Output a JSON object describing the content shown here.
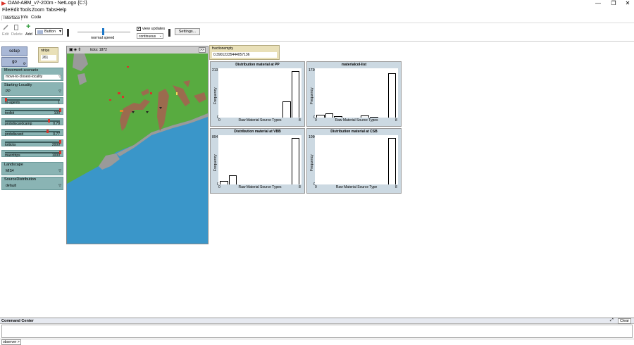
{
  "window": {
    "title": "OAM-ABM_v7-200m - NetLogo {C:\\}",
    "minimize": "—",
    "maximize": "❐",
    "close": "✕"
  },
  "menu": [
    "File",
    "Edit",
    "Tools",
    "Zoom",
    "Tabs",
    "Help"
  ],
  "tabs": [
    "Interface",
    "Info",
    "Code"
  ],
  "toolbar": {
    "edit": "Edit",
    "delete": "Delete",
    "add": "Add",
    "widget_type": "Button",
    "speed_label": "normal speed",
    "view_updates": "view updates",
    "update_mode": "continuous",
    "settings": "Settings..."
  },
  "buttons": {
    "setup": "setup",
    "go": "go"
  },
  "monitor_ntrips": {
    "label": "ntrips",
    "value": "261"
  },
  "monitor_fractionempty": {
    "label": "fractionempty",
    "value": "0.39012235444057136"
  },
  "choosers": [
    {
      "label": "Movement-scenario",
      "value": "move-to-closest-locality"
    },
    {
      "label": "Starting-Locality",
      "value": "PP"
    }
  ],
  "sliders": [
    {
      "label": "nr-agents",
      "value": "1",
      "pos": 0.0
    },
    {
      "label": "toolkit",
      "value": "100",
      "pos": 1.0
    },
    {
      "label": "probdiscardcamp",
      "value": "0.79",
      "pos": 0.79
    },
    {
      "label": "probdiscard",
      "value": "0.77",
      "pos": 0.77
    },
    {
      "label": "totticks",
      "value": "2000",
      "pos": 1.0
    },
    {
      "label": "maxntrips",
      "value": "1000",
      "pos": 1.0
    }
  ],
  "choosers2": [
    {
      "label": "Landscape",
      "value": "MIS4"
    },
    {
      "label": "SourceDistribution",
      "value": "default"
    }
  ],
  "view": {
    "ticks_label": "ticks: 1872",
    "speed_btn": ">>"
  },
  "plots": [
    {
      "title": "Distribution material at PP",
      "ymax": "213",
      "ylabel": "Frequency",
      "xlabel": "Raw Material Source Types",
      "xmin": "0",
      "xmax": "8",
      "values": [
        0,
        0,
        0,
        0,
        0,
        0,
        0,
        0.35,
        1.0
      ]
    },
    {
      "title": "materialcol-list",
      "ymax": "173000",
      "ylabel": "Frequency",
      "xlabel": "Raw Material Source Types",
      "xmin": "0",
      "xmax": "8",
      "values": [
        0.06,
        0.09,
        0.03,
        0,
        0,
        0.05,
        0.02,
        0,
        0.95
      ]
    },
    {
      "title": "Distribution material at VBB",
      "ymax": "894",
      "ylabel": "Frequency",
      "xlabel": "Raw Material Source Types",
      "xmin": "0",
      "xmax": "8",
      "values": [
        0.08,
        0.2,
        0,
        0,
        0,
        0,
        0,
        0,
        1.0
      ]
    },
    {
      "title": "Distribution material at CSB",
      "ymax": "1090",
      "ylabel": "Frequency",
      "xlabel": "Raw Material Source Type",
      "xmin": "0",
      "xmax": "8",
      "values": [
        0,
        0,
        0,
        0,
        0,
        0,
        0,
        0,
        1.0
      ]
    }
  ],
  "command_center": {
    "title": "Command Center",
    "clear": "Clear",
    "prompt": "observer >"
  },
  "colors": {
    "button": "#a9b8d6",
    "widget": "#8ab4b4",
    "plot_bg": "#ccd9e2",
    "ocean": "#3a96c9",
    "land": "#58ab40",
    "mountain": "#9b6b4e",
    "shore": "#9a9a9a"
  }
}
